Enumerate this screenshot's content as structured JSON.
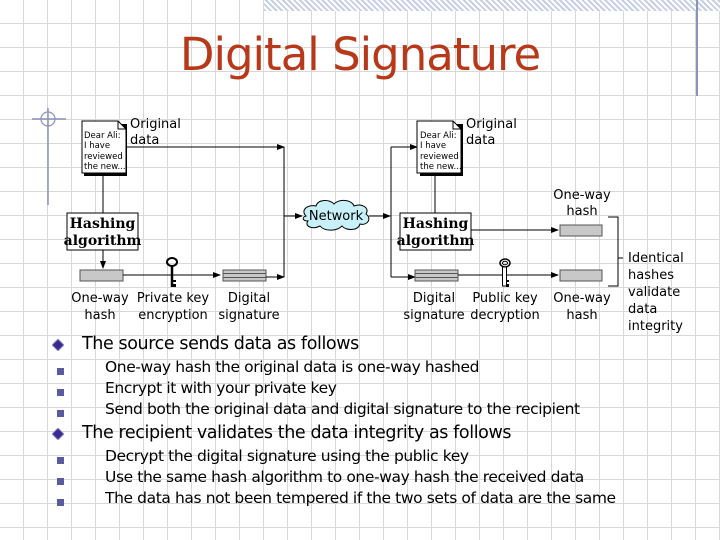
{
  "title": "Digital Signature",
  "colors": {
    "title": "#b8391a",
    "network_cloud": "#c8f0f8",
    "hash_box": "#c8c8c8",
    "bullet_diamond": "#3a2a8c",
    "bullet_square": "#5a5aa0",
    "accent_line": "#8a94b8"
  },
  "diagram": {
    "sender": {
      "document": {
        "lines": [
          "Dear Ali:",
          "I have",
          "reviewed",
          "the new..."
        ],
        "label_line1": "Original",
        "label_line2": "data",
        "icon": "document-icon"
      },
      "hashing_box": {
        "line1": "Hashing",
        "line2": "algorithm"
      },
      "hash_label": {
        "line1": "One-way",
        "line2": "hash"
      },
      "key_label": {
        "line1": "Private key",
        "line2": "encryption",
        "icon": "key-icon"
      },
      "signature_label": {
        "line1": "Digital",
        "line2": "signature"
      }
    },
    "network": {
      "label": "Network",
      "icon": "cloud-icon"
    },
    "recipient": {
      "document": {
        "lines": [
          "Dear Ali:",
          "I have",
          "reviewed",
          "the new..."
        ],
        "label_line1": "Original",
        "label_line2": "data",
        "icon": "document-icon"
      },
      "hashing_box": {
        "line1": "Hashing",
        "line2": "algorithm"
      },
      "top_hash_label": {
        "line1": "One-way",
        "line2": "hash"
      },
      "signature_label": {
        "line1": "Digital",
        "line2": "signature"
      },
      "key_label": {
        "line1": "Public key",
        "line2": "decryption",
        "icon": "key-icon"
      },
      "bottom_hash_label": {
        "line1": "One-way",
        "line2": "hash"
      },
      "conclusion": [
        "Identical",
        "hashes",
        "validate",
        "data",
        "integrity"
      ]
    }
  },
  "bullets": [
    {
      "text": "The source sends data as follows",
      "items": [
        "One-way hash the original data is one-way hashed",
        "Encrypt it with your private key",
        "Send both the original data and digital signature to the recipient"
      ]
    },
    {
      "text": "The recipient validates the data integrity as follows",
      "items": [
        "Decrypt the digital signature using the public key",
        "Use the same hash algorithm to one-way hash the received data",
        "The data has not been tempered if the two sets of data are the same"
      ]
    }
  ]
}
